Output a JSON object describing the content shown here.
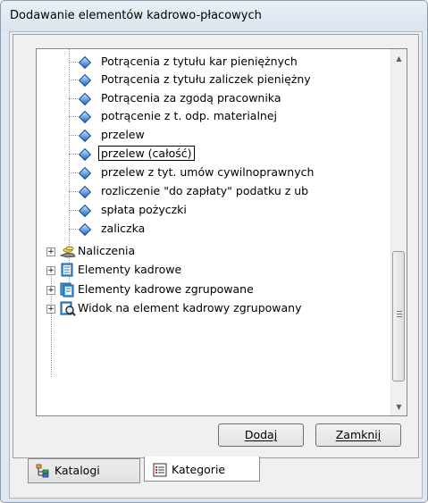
{
  "window": {
    "title": "Dodawanie elementów kadrowo-płacowych"
  },
  "tree": {
    "leaf_items": [
      "Potrącenia z tytułu kar pieniężnych",
      "Potrącenia z tytułu zaliczek pieniężny",
      "Potrącenia za zgodą pracownika",
      "potrącenie z t. odp. materialnej",
      "przelew",
      "przelew (całość)",
      "przelew z tyt. umów cywilnoprawnych",
      "rozliczenie \"do zapłaty\" podatku z ub",
      "spłata pożyczki",
      "zaliczka"
    ],
    "selected_index": 5,
    "groups": [
      {
        "label": "Naliczenia",
        "icon": "hand-coins-icon"
      },
      {
        "label": "Elementy kadrowe",
        "icon": "document-list-icon"
      },
      {
        "label": "Elementy kadrowe zgrupowane",
        "icon": "stacked-documents-icon"
      },
      {
        "label": "Widok na element kadrowy zgrupowany",
        "icon": "magnifier-document-icon"
      }
    ]
  },
  "buttons": {
    "add": "Dodaj",
    "close": "Zamknij"
  },
  "tabs": [
    {
      "label": "Katalogi",
      "icon": "catalog-tree-icon",
      "active": false
    },
    {
      "label": "Kategorie",
      "icon": "category-list-icon",
      "active": true
    }
  ],
  "colors": {
    "titlebar": "#dfe7f1",
    "selection_border": "#000000",
    "diamond": "#1d68c8"
  }
}
